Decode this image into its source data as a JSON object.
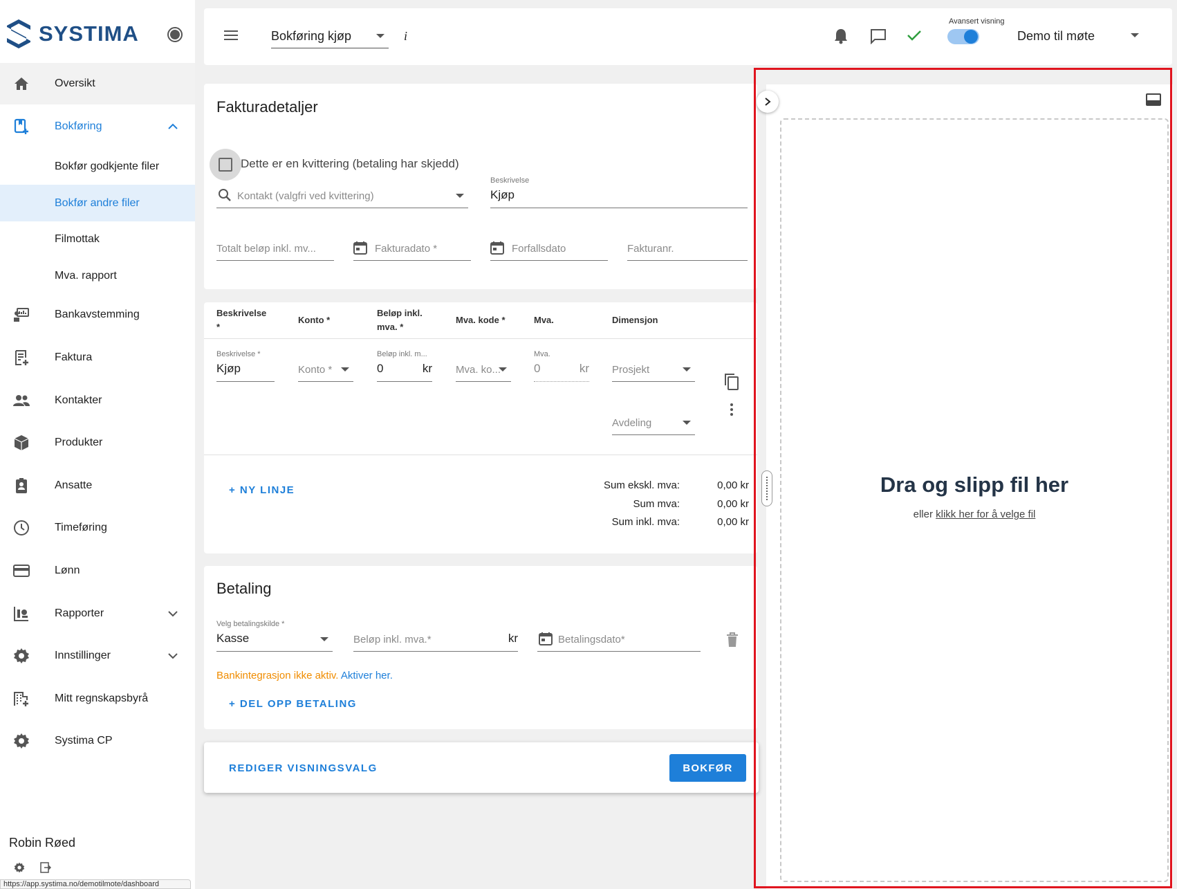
{
  "brand": {
    "name": "SYSTIMA"
  },
  "sidebar": {
    "items": [
      {
        "label": "Oversikt",
        "icon": "home-icon"
      },
      {
        "label": "Bokføring",
        "icon": "bookkeeping-icon"
      },
      {
        "label": "Bokfør godkjente filer"
      },
      {
        "label": "Bokfør andre filer"
      },
      {
        "label": "Filmottak"
      },
      {
        "label": "Mva. rapport"
      },
      {
        "label": "Bankavstemming",
        "icon": "bank-icon"
      },
      {
        "label": "Faktura",
        "icon": "invoice-icon"
      },
      {
        "label": "Kontakter",
        "icon": "contacts-icon"
      },
      {
        "label": "Produkter",
        "icon": "box-icon"
      },
      {
        "label": "Ansatte",
        "icon": "badge-icon"
      },
      {
        "label": "Timeføring",
        "icon": "clock-icon"
      },
      {
        "label": "Lønn",
        "icon": "card-icon"
      },
      {
        "label": "Rapporter",
        "icon": "chart-icon"
      },
      {
        "label": "Innstillinger",
        "icon": "gear-icon"
      },
      {
        "label": "Mitt regnskapsbyrå",
        "icon": "building-icon"
      },
      {
        "label": "Systima CP",
        "icon": "gear-icon"
      }
    ],
    "user_name": "Robin Røed",
    "status_url": "https://app.systima.no/demotilmote/dashboard"
  },
  "topbar": {
    "page_select": "Bokføring kjøp",
    "info": "i",
    "advanced_label": "Avansert visning",
    "company": "Demo til møte"
  },
  "invoice": {
    "title": "Fakturadetaljer",
    "receipt_checkbox": "Dette er en kvittering (betaling har skjedd)",
    "contact_placeholder": "Kontakt (valgfri ved kvittering)",
    "description_label": "Beskrivelse",
    "description_value": "Kjøp",
    "total_placeholder": "Totalt beløp inkl. mv...",
    "invoice_date_placeholder": "Fakturadato *",
    "due_date_placeholder": "Forfallsdato",
    "invoice_no_placeholder": "Fakturanr."
  },
  "lines": {
    "headers": {
      "description": "Beskrivelse",
      "description_star": "*",
      "account": "Konto *",
      "amount_1": "Beløp inkl.",
      "amount_2": "mva. *",
      "vat_code": "Mva. kode *",
      "vat": "Mva.",
      "dimension": "Dimensjon"
    },
    "row": {
      "desc_label": "Beskrivelse *",
      "desc_value": "Kjøp",
      "account_placeholder": "Konto *",
      "amount_label": "Beløp inkl. m...",
      "amount_value": "0",
      "currency": "kr",
      "vat_code_placeholder": "Mva. ko...",
      "vat_label": "Mva.",
      "vat_value": "0",
      "project_placeholder": "Prosjekt",
      "department_placeholder": "Avdeling"
    },
    "new_line": "+ NY LINJE",
    "sums": [
      {
        "label": "Sum ekskl. mva:",
        "value": "0,00 kr"
      },
      {
        "label": "Sum mva:",
        "value": "0,00 kr"
      },
      {
        "label": "Sum inkl. mva:",
        "value": "0,00 kr"
      }
    ]
  },
  "payment": {
    "title": "Betaling",
    "source_label": "Velg betalingskilde *",
    "source_value": "Kasse",
    "amount_placeholder": "Beløp inkl. mva.*",
    "currency": "kr",
    "date_placeholder": "Betalingsdato*",
    "bank_warning": "Bankintegrasjon ikke aktiv.",
    "bank_link": "Aktiver her.",
    "split": "+ DEL OPP BETALING"
  },
  "footer": {
    "edit_view": "REDIGER VISNINGSVALG",
    "submit": "BOKFØR"
  },
  "dropzone": {
    "title": "Dra og slipp fil her",
    "sub_prefix": "eller",
    "sub_link": "klikk her for å velge fil"
  },
  "colors": {
    "accent": "#1e7fd9",
    "warning": "#f08c00",
    "highlight_frame": "#e0141e",
    "success": "#2e9e3e"
  }
}
